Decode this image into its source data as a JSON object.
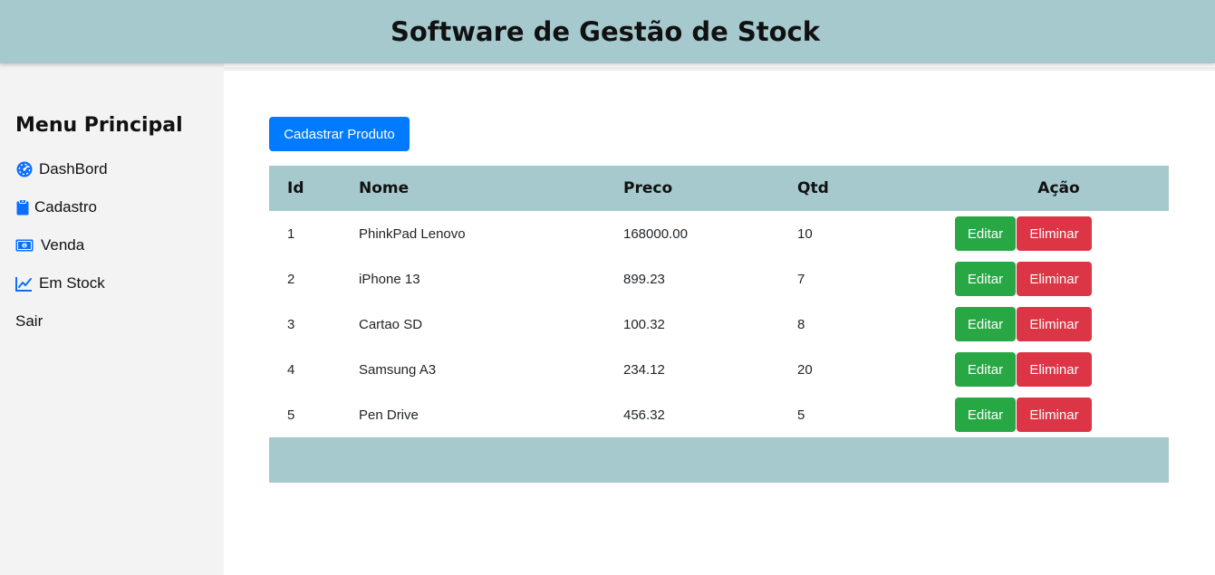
{
  "header": {
    "title": "Software de Gestão de Stock"
  },
  "sidebar": {
    "title": "Menu Principal",
    "items": [
      {
        "label": "DashBord",
        "icon": "dashboard-gauge-icon"
      },
      {
        "label": "Cadastro",
        "icon": "clipboard-icon"
      },
      {
        "label": "Venda",
        "icon": "money-bill-icon"
      },
      {
        "label": "Em Stock",
        "icon": "chart-line-icon"
      },
      {
        "label": "Sair",
        "icon": ""
      }
    ]
  },
  "main": {
    "add_button": "Cadastrar Produto",
    "table": {
      "headers": {
        "id": "Id",
        "nome": "Nome",
        "preco": "Preco",
        "qtd": "Qtd",
        "acao": "Ação"
      },
      "rows": [
        {
          "id": "1",
          "nome": "PhinkPad Lenovo",
          "preco": "168000.00",
          "qtd": "10"
        },
        {
          "id": "2",
          "nome": "iPhone 13",
          "preco": "899.23",
          "qtd": "7"
        },
        {
          "id": "3",
          "nome": "Cartao SD",
          "preco": "100.32",
          "qtd": "8"
        },
        {
          "id": "4",
          "nome": "Samsung A3",
          "preco": "234.12",
          "qtd": "20"
        },
        {
          "id": "5",
          "nome": "Pen Drive",
          "preco": "456.32",
          "qtd": "5"
        }
      ],
      "edit_label": "Editar",
      "delete_label": "Eliminar"
    }
  },
  "colors": {
    "header_bg": "#a6c9ce",
    "sidebar_bg": "#f3f3f3",
    "primary": "#007bff",
    "success": "#28a745",
    "danger": "#dc3545",
    "icon_blue": "#0d6efd"
  }
}
